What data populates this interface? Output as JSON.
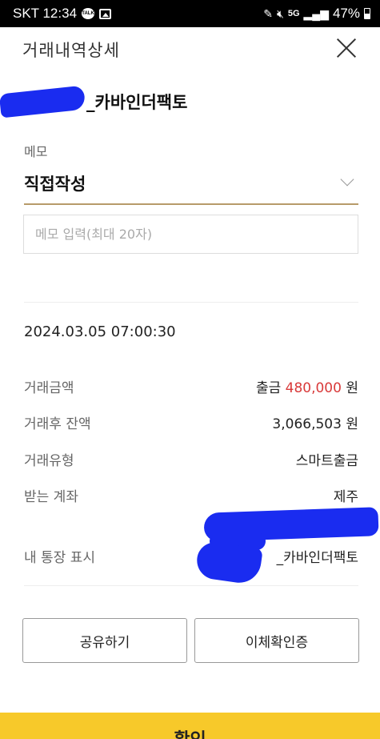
{
  "status_bar": {
    "carrier_time": "SKT 12:34",
    "talk_icon_text": "TALK",
    "network": "5G",
    "battery": "47%"
  },
  "header": {
    "title": "거래내역상세",
    "close_icon": "close-icon"
  },
  "account": {
    "name": "_카바인더팩토"
  },
  "memo": {
    "label": "메모",
    "selected": "직접작성",
    "input_placeholder": "메모 입력(최대 20자)",
    "input_value": ""
  },
  "transaction": {
    "datetime": "2024.03.05 07:00:30",
    "rows": [
      {
        "label": "거래금액",
        "prefix": "출금",
        "amount": "480,000",
        "unit": "원"
      },
      {
        "label": "거래후 잔액",
        "value": "3,066,503",
        "unit": "원"
      },
      {
        "label": "거래유형",
        "value": "스마트출금"
      },
      {
        "label": "받는 계좌",
        "value": "제주"
      },
      {
        "label": "내 통장 표시",
        "value": "_카바인더팩토"
      }
    ]
  },
  "buttons": {
    "share": "공유하기",
    "transfer_cert": "이체확인증",
    "confirm": "확인"
  },
  "colors": {
    "accent_underline": "#b79b6a",
    "withdraw_amount": "#d93a3a",
    "confirm_bar": "#f7c92a",
    "redaction": "#1a2cf0"
  }
}
